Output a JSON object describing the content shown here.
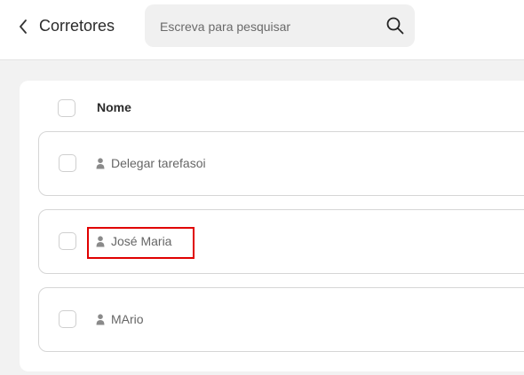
{
  "header": {
    "title": "Corretores",
    "back_icon": "chevron-left-icon"
  },
  "search": {
    "placeholder": "Escreva para pesquisar",
    "value": "",
    "icon": "search-icon"
  },
  "table": {
    "column_name": "Nome",
    "rows": [
      {
        "name": "Delegar tarefasoi",
        "icon": "person-icon"
      },
      {
        "name": "José Maria",
        "icon": "person-icon"
      },
      {
        "name": "MArio",
        "icon": "person-icon"
      }
    ]
  },
  "colors": {
    "highlight": "#e00000",
    "background": "#f2f2f2",
    "border": "#d6d6d6"
  }
}
